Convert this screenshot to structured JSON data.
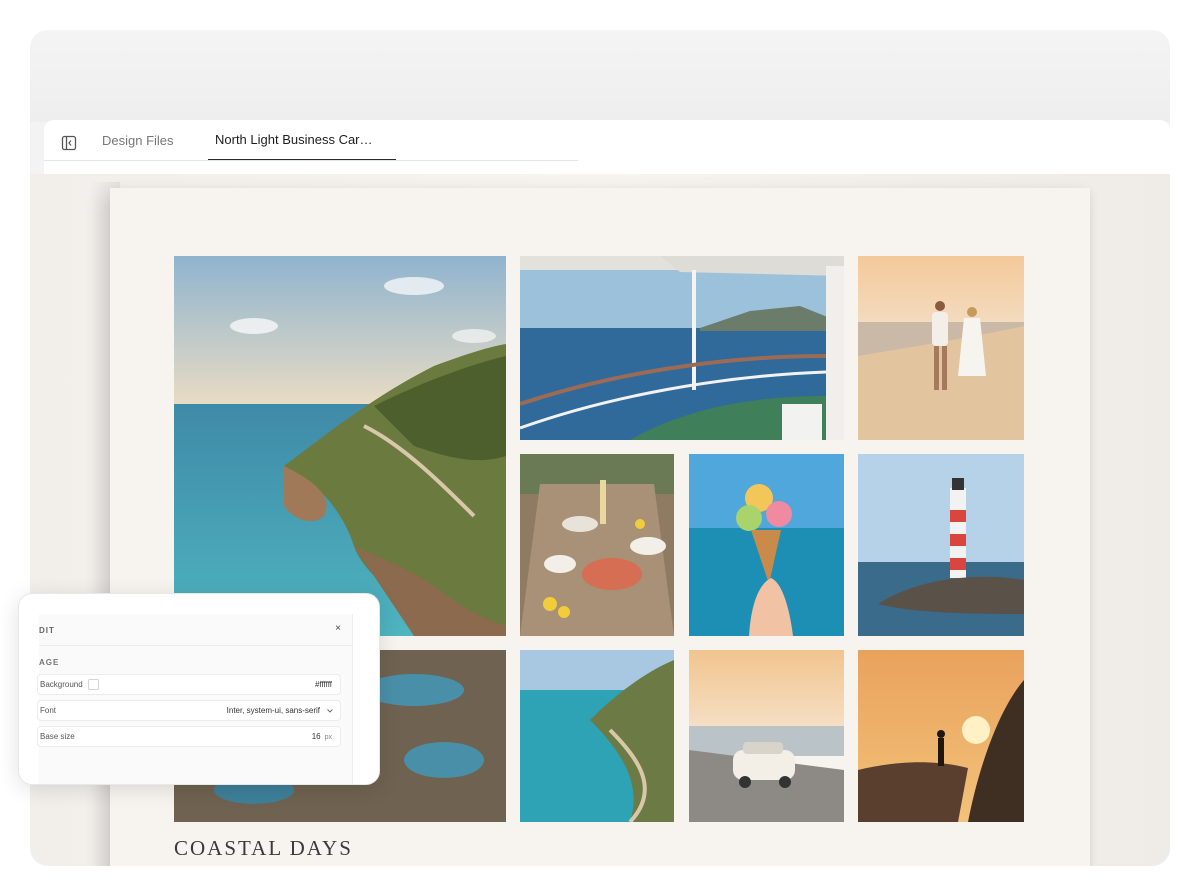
{
  "tabs": {
    "design_files": "Design Files",
    "active_doc": "North Light Business Car…"
  },
  "poster": {
    "title": "COASTAL DAYS"
  },
  "edit_panel": {
    "title": "DIT",
    "close": "×",
    "section": "AGE",
    "rows": {
      "background_label": "Background",
      "background_value": "#ffffff",
      "font_label": "Font",
      "font_value": "Inter, system-ui, sans-serif",
      "base_size_label": "Base size",
      "base_size_value": "16",
      "base_size_unit": "px"
    }
  },
  "icons": {
    "sidebar_toggle": "sidebar-toggle-icon",
    "close": "close-icon",
    "chevron": "chevron-down-icon"
  },
  "colors": {
    "paper": "#f7f4ef",
    "tab_active": "#1e1e1e",
    "tab_inactive": "#777777"
  }
}
